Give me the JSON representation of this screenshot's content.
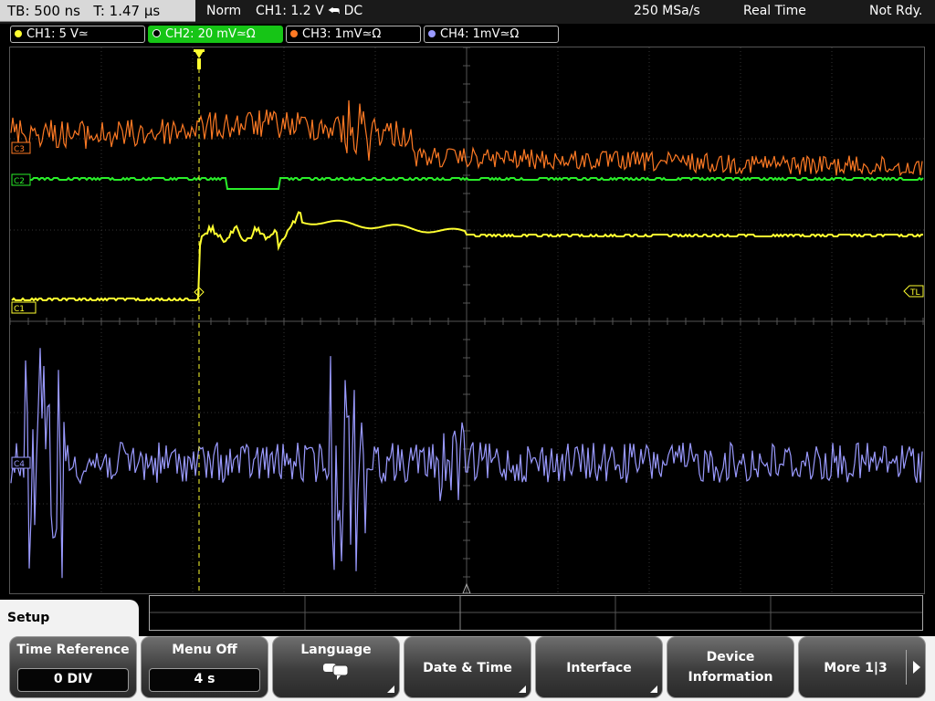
{
  "status": {
    "timebase": "TB: 500 ns",
    "trigger_time": "T: 1.47 µs",
    "acq_mode": "Norm",
    "trigger_info": "CH1: 1.2 V ⮪ DC",
    "sample_rate": "250 MSa/s",
    "acq_type": "Real Time",
    "status": "Not Rdy."
  },
  "channels": [
    {
      "label": "CH1: 5 V≃",
      "color": "#ffff30"
    },
    {
      "label": "CH2: 20 mV≃Ω",
      "color": "#2aee2a"
    },
    {
      "label": "CH3: 1mV≃Ω",
      "color": "#ff7a24"
    },
    {
      "label": "CH4: 1mV≃Ω",
      "color": "#9a9aff"
    }
  ],
  "markers": {
    "c1": "C1",
    "c2": "C2",
    "c3": "C3",
    "c4": "C4",
    "tl": "TL"
  },
  "menu": {
    "tab": "Setup",
    "time_reference": {
      "title": "Time Reference",
      "value": "0 DIV"
    },
    "menu_off": {
      "title": "Menu Off",
      "value": "4 s"
    },
    "language": {
      "title": "Language"
    },
    "date_time": "Date & Time",
    "interface": "Interface",
    "device_info_1": "Device",
    "device_info_2": "Information",
    "more": "More 1|3"
  }
}
